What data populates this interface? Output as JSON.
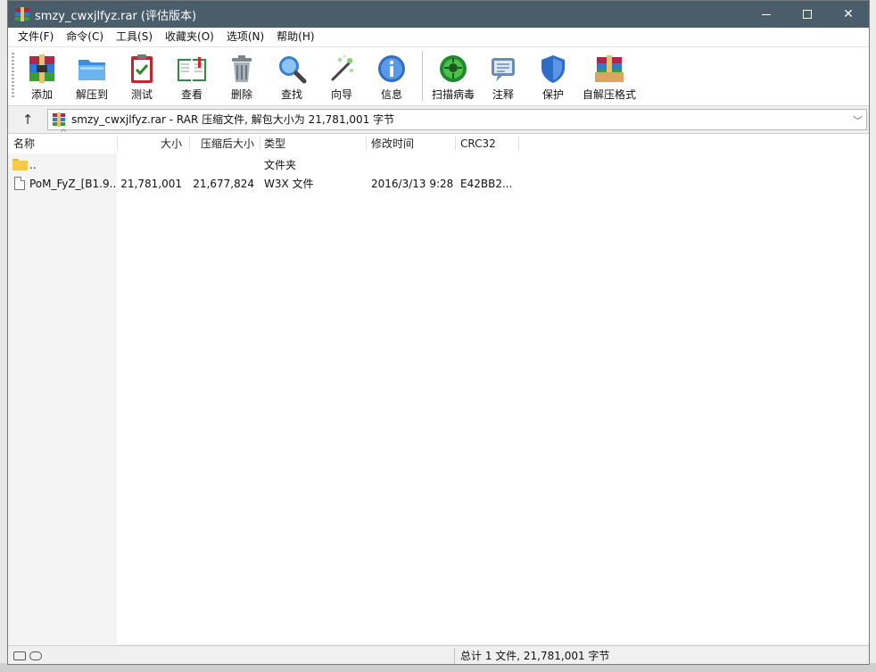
{
  "window": {
    "title": "smzy_cwxjlfyz.rar (评估版本)"
  },
  "menu": [
    "文件(F)",
    "命令(C)",
    "工具(S)",
    "收藏夹(O)",
    "选项(N)",
    "帮助(H)"
  ],
  "toolbar": {
    "add": "添加",
    "extract": "解压到",
    "test": "测试",
    "view": "查看",
    "delete": "删除",
    "find": "查找",
    "wizard": "向导",
    "info": "信息",
    "scan": "扫描病毒",
    "comment": "注释",
    "protect": "保护",
    "sfx": "自解压格式"
  },
  "address": {
    "text": "smzy_cwxjlfyz.rar - RAR 压缩文件, 解包大小为 21,781,001 字节"
  },
  "columns": {
    "name": "名称",
    "size": "大小",
    "packed": "压缩后大小",
    "type": "类型",
    "modified": "修改时间",
    "crc": "CRC32"
  },
  "files": [
    {
      "name": "..",
      "size": "",
      "packed": "",
      "type": "文件夹",
      "modified": "",
      "crc": ""
    },
    {
      "name": "PoM_FyZ_[B1.9...",
      "size": "21,781,001",
      "packed": "21,677,824",
      "type": "W3X 文件",
      "modified": "2016/3/13 9:28",
      "crc": "E42BB2..."
    }
  ],
  "status": {
    "text": "总计 1 文件, 21,781,001 字节"
  },
  "colors": {
    "titlebar": "#4a5d6a"
  }
}
